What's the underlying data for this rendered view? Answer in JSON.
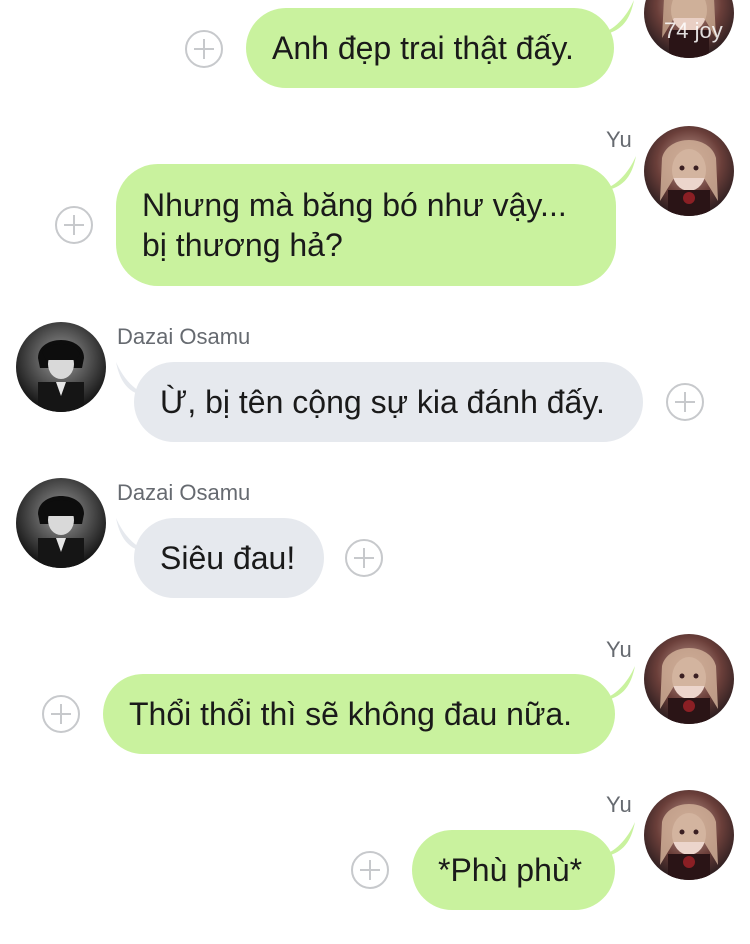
{
  "messages": [
    {
      "id": "m1",
      "side": "out",
      "sender": "",
      "text_lines": [
        "Anh đẹp trai thật đấy."
      ]
    },
    {
      "id": "m2",
      "side": "out",
      "sender": "Yu",
      "text_lines": [
        "Nhưng mà băng bó như vậy...",
        "bị thương hả?"
      ]
    },
    {
      "id": "m3",
      "side": "in",
      "sender": "Dazai Osamu",
      "text_lines": [
        "Ừ, bị tên cộng sự kia đánh đấy."
      ]
    },
    {
      "id": "m4",
      "side": "in",
      "sender": "Dazai Osamu",
      "text_lines": [
        "Siêu đau!"
      ]
    },
    {
      "id": "m5",
      "side": "out",
      "sender": "Yu",
      "text_lines": [
        "Thổi thổi thì sẽ không đau nữa."
      ]
    },
    {
      "id": "m6",
      "side": "out",
      "sender": "Yu",
      "text_lines": [
        "*Phù phù*"
      ]
    }
  ],
  "top_avatar_tag": "74 joy",
  "icons": {
    "reaction": "plus-circle-icon",
    "avatar_yu": "avatar-yu",
    "avatar_dazai": "avatar-dazai"
  },
  "colors": {
    "outgoing_bubble": "#c9f29e",
    "incoming_bubble": "#e6e9ee",
    "sender_name": "#666a70",
    "background": "#ffffff"
  }
}
